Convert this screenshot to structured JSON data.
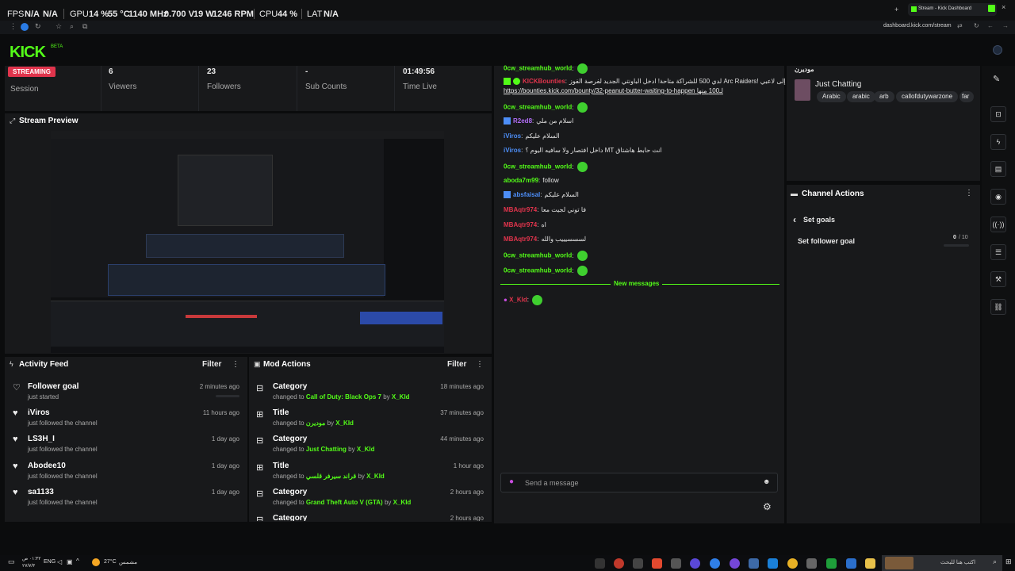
{
  "osd": {
    "fps_label": "FPS",
    "fps_value": "N/A",
    "n_a": "N/A",
    "gpu_label": "GPU",
    "gpu_load": "14 %",
    "gpu_temp": "55 °C",
    "gpu_clock": "1140 MHz",
    "gpu_volt": "0.700 V",
    "gpu_power": "19 W",
    "gpu_fan": "1246 RPM",
    "cpu_label": "CPU",
    "cpu_load": "44 %",
    "lat_label": "LAT",
    "lat_value": "N/A"
  },
  "browser": {
    "tab_title": "Stream - Kick Dashboard",
    "url": "dashboard.kick.com/stream"
  },
  "header": {
    "logo": "KICK",
    "beta": "BETA"
  },
  "stats": {
    "status_badge": "STREAMING",
    "session_label": "Session",
    "viewers_value": "6",
    "viewers_label": "Viewers",
    "followers_value": "23",
    "followers_label": "Followers",
    "subs_value": "-",
    "subs_label": "Sub Counts",
    "time_value": "01:49:56",
    "time_label": "Time Live"
  },
  "preview": {
    "title": "Stream Preview"
  },
  "activity": {
    "title": "Activity Feed",
    "filter": "Filter",
    "items": [
      {
        "title": "Follower goal",
        "sub": "just started",
        "time": "2 minutes ago"
      },
      {
        "title": "iViros",
        "sub": "just followed the channel",
        "time": "11 hours ago"
      },
      {
        "title": "LS3H_I",
        "sub": "just followed the channel",
        "time": "1 day ago"
      },
      {
        "title": "Abodee10",
        "sub": "just followed the channel",
        "time": "1 day ago"
      },
      {
        "title": "sa1133",
        "sub": "just followed the channel",
        "time": "1 day ago"
      }
    ]
  },
  "mod": {
    "title": "Mod Actions",
    "filter": "Filter",
    "items": [
      {
        "title": "Category",
        "pre": "changed to",
        "value": "Call of Duty: Black Ops 7",
        "by": "by",
        "user": "X_KId",
        "time": "18 minutes ago"
      },
      {
        "title": "Title",
        "pre": "changed to",
        "value": "موديرن",
        "by": "by",
        "user": "X_KId",
        "time": "37 minutes ago"
      },
      {
        "title": "Category",
        "pre": "changed to",
        "value": "Just Chatting",
        "by": "by",
        "user": "X_KId",
        "time": "44 minutes ago"
      },
      {
        "title": "Title",
        "pre": "changed to",
        "value": "قراند سيرفر قلسي",
        "by": "by",
        "user": "X_KId",
        "time": "1 hour ago"
      },
      {
        "title": "Category",
        "pre": "changed to",
        "value": "Grand Theft Auto V (GTA)",
        "by": "by",
        "user": "X_KId",
        "time": "2 hours ago"
      },
      {
        "title": "Category",
        "time": "2 hours ago"
      }
    ]
  },
  "chat": {
    "lines": [
      {
        "user": "0cw_streamhub_world",
        "text": "",
        "cls": "u-green",
        "emote": true
      },
      {
        "user": "KICKBounties",
        "text": "لدي 500 للشراكة متاحة! ادخل الباونتي الجديد لفرصة الفوز Arc Raiders! إلى لاعبي",
        "cls": "u-red",
        "emote": false
      },
      {
        "user": "",
        "text": "https://bounties.kick.com/bounty/32-peanut-butter-waiting-to-happen لـ100 منها",
        "cls": "",
        "emote": false
      },
      {
        "user": "0cw_streamhub_world",
        "text": "",
        "cls": "u-green",
        "emote": true
      },
      {
        "user": "R2ed8",
        "text": "اسلام من ملي",
        "cls": "u-purple",
        "emote": false
      },
      {
        "user": "iViros",
        "text": "السلام عليكم",
        "cls": "u-blue",
        "emote": false
      },
      {
        "user": "iViros",
        "text": "داخل افتصار ولا سافيه اليوم ؟ MT انت حابط هاشتاق",
        "cls": "u-blue",
        "emote": false
      },
      {
        "user": "0cw_streamhub_world",
        "text": "",
        "cls": "u-green",
        "emote": true
      },
      {
        "user": "aboda7m99",
        "text": "follow",
        "cls": "u-green",
        "emote": false
      },
      {
        "user": "absfaisal",
        "text": "السلام عليكم",
        "cls": "u-blue",
        "emote": false
      },
      {
        "user": "MBAqtr974",
        "text": "فا توني لجيت معا",
        "cls": "u-red",
        "emote": false
      },
      {
        "user": "MBAqtr974",
        "text": "اه",
        "cls": "u-red",
        "emote": false
      },
      {
        "user": "MBAqtr974",
        "text": "لسسسيييب والله",
        "cls": "u-red",
        "emote": false
      },
      {
        "user": "0cw_streamhub_world",
        "text": "",
        "cls": "u-green",
        "emote": true
      },
      {
        "user": "0cw_streamhub_world",
        "text": "",
        "cls": "u-green",
        "emote": true
      }
    ],
    "new_messages": "New messages",
    "last_user": "X_KId",
    "input_placeholder": "Send a message"
  },
  "stream_info": {
    "title": "موديرن",
    "category": "Just Chatting",
    "tags": [
      "Arabic",
      "arabic",
      "arb",
      "callofdutywarzone",
      "far"
    ]
  },
  "channel_actions": {
    "title": "Channel Actions",
    "back_label": "Set goals",
    "goal_label": "Set follower goal",
    "goal_current": "0",
    "goal_total": "/ 10",
    "goal_progress": 0
  },
  "taskbar": {
    "weather": "27°C",
    "weather_text": "مشمس",
    "lang": "ENG",
    "search_text": "اكتب هنا للبحث",
    "time": "٠١:٣٢ ص",
    "date": "٢٧/٧/٣"
  },
  "colors": {
    "accent": "#53fc18",
    "live": "#e0344c",
    "panel": "#18191b"
  }
}
